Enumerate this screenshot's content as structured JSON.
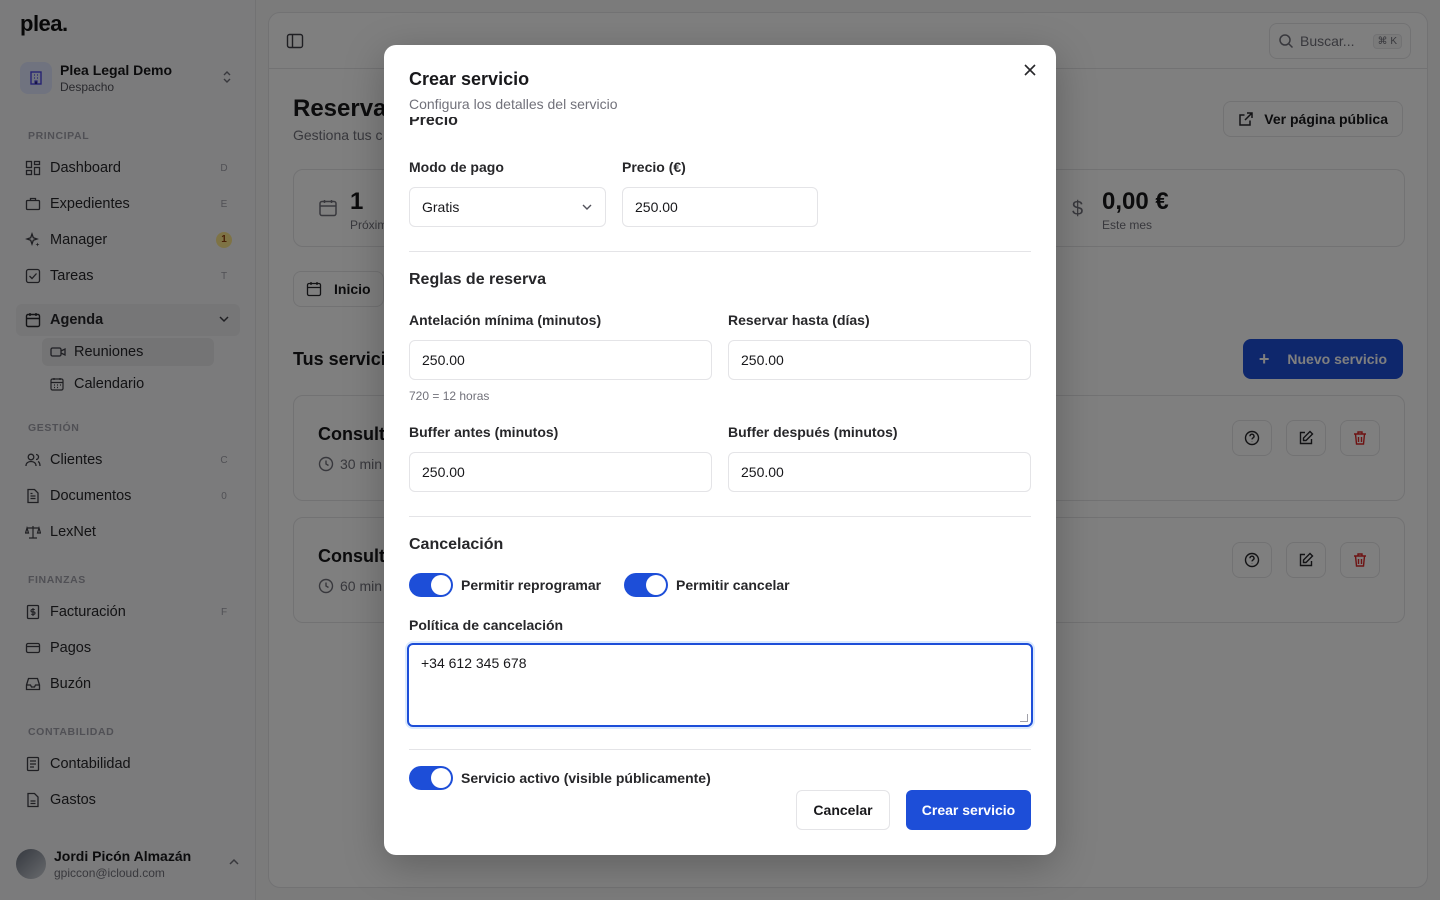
{
  "app": {
    "logo": "plea."
  },
  "org": {
    "name": "Plea Legal Demo",
    "type": "Despacho"
  },
  "sidebar": {
    "sections": {
      "principal": "PRINCIPAL",
      "gestion": "GESTIÓN",
      "finanzas": "FINANZAS",
      "contabilidad": "CONTABILIDAD"
    },
    "items": {
      "dashboard": {
        "label": "Dashboard",
        "kbd": "D"
      },
      "expedientes": {
        "label": "Expedientes",
        "kbd": "E"
      },
      "manager": {
        "label": "Manager",
        "badge": "1"
      },
      "tareas": {
        "label": "Tareas",
        "kbd": "T"
      },
      "agenda": {
        "label": "Agenda"
      },
      "reuniones": {
        "label": "Reuniones"
      },
      "calendario": {
        "label": "Calendario"
      },
      "clientes": {
        "label": "Clientes",
        "kbd": "C"
      },
      "documentos": {
        "label": "Documentos",
        "kbd": "0"
      },
      "lexnet": {
        "label": "LexNet"
      },
      "facturacion": {
        "label": "Facturación",
        "kbd": "F"
      },
      "pagos": {
        "label": "Pagos"
      },
      "buzon": {
        "label": "Buzón"
      },
      "contabilidad": {
        "label": "Contabilidad"
      },
      "gastos": {
        "label": "Gastos"
      }
    }
  },
  "user": {
    "name": "Jordi Picón Almazán",
    "email": "gpiccon@icloud.com"
  },
  "topbar": {
    "search_placeholder": "Buscar...",
    "search_kbd": "⌘ K"
  },
  "page": {
    "title": "Reserva",
    "subtitle": "Gestiona tus c",
    "public_button": "Ver página pública",
    "stats": [
      {
        "value": "1",
        "label": "Próxim"
      },
      {
        "value": "0,00 €",
        "label": "Este mes"
      }
    ],
    "tab_inicio": "Inicio",
    "services_title": "Tus servici",
    "new_service_button": "Nuevo servicio",
    "services": [
      {
        "name": "Consult",
        "duration": "30 min"
      },
      {
        "name": "Consult",
        "duration": "60 min"
      }
    ]
  },
  "modal": {
    "title": "Crear servicio",
    "subtitle": "Configura los detalles del servicio",
    "cut_section": "Precio",
    "payment_mode_label": "Modo de pago",
    "payment_mode_value": "Gratis",
    "price_label": "Precio (€)",
    "price_value": "250.00",
    "booking_rules_title": "Reglas de reserva",
    "min_notice_label": "Antelación mínima (minutos)",
    "min_notice_value": "250.00",
    "min_notice_hint": "720 = 12 horas",
    "book_until_label": "Reservar hasta (días)",
    "book_until_value": "250.00",
    "buffer_before_label": "Buffer antes (minutos)",
    "buffer_before_value": "250.00",
    "buffer_after_label": "Buffer después (minutos)",
    "buffer_after_value": "250.00",
    "cancellation_title": "Cancelación",
    "allow_reschedule_label": "Permitir reprogramar",
    "allow_reschedule_on": true,
    "allow_cancel_label": "Permitir cancelar",
    "allow_cancel_on": true,
    "policy_label": "Política de cancelación",
    "policy_value": "+34 612 345 678",
    "active_label": "Servicio activo (visible públicamente)",
    "active_on": true,
    "cancel_button": "Cancelar",
    "create_button": "Crear servicio"
  },
  "colors": {
    "accent": "#1d4ed8",
    "overlay": "rgba(0,0,0,0.5)"
  }
}
